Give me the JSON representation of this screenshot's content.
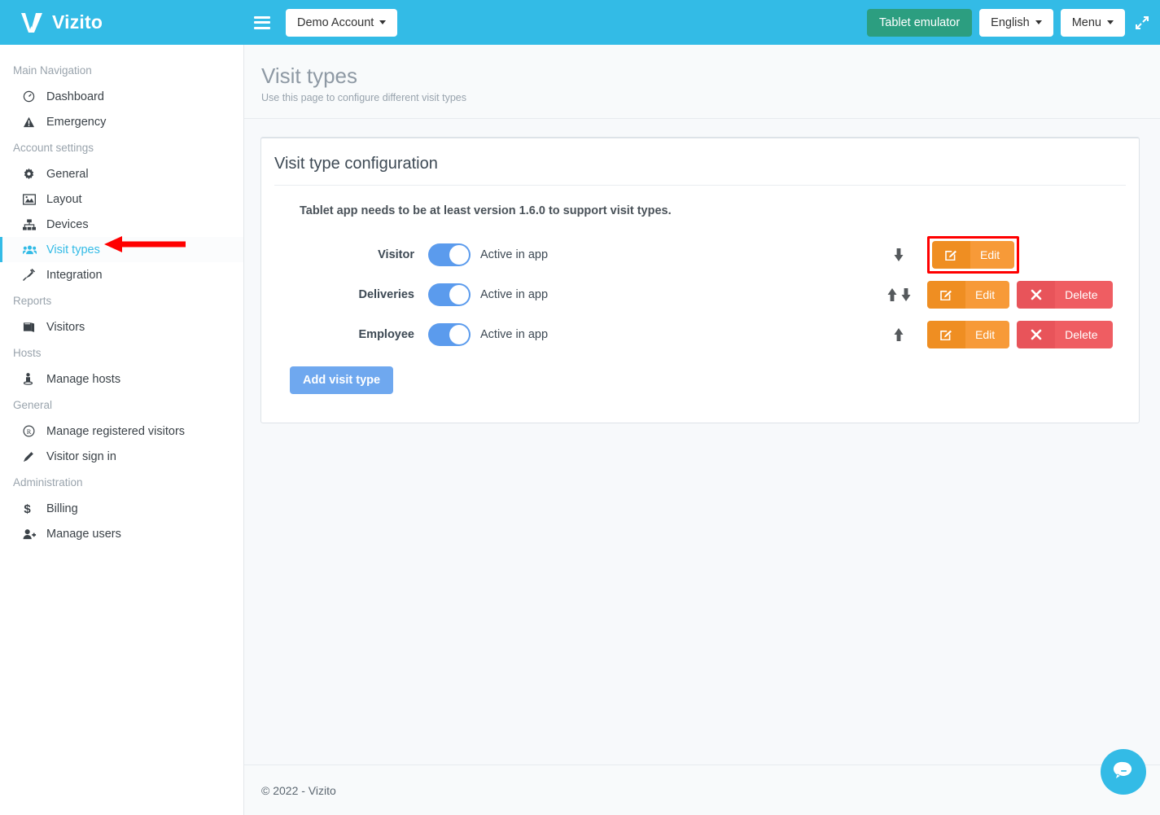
{
  "app": {
    "brand_name": "Vizito",
    "brand_logo_icon": "vizito-checkmark-logo",
    "accent_color": "#33bbe6"
  },
  "topbar": {
    "menu_toggle_icon": "hamburger-icon",
    "account_button": "Demo Account",
    "tablet_emulator_button": "Tablet emulator",
    "language_button": "English",
    "menu_button": "Menu",
    "expand_icon": "expand-arrows-icon",
    "emulator_color": "#2c9e80"
  },
  "sidebar": {
    "groups": [
      {
        "header": "Main Navigation",
        "items": [
          {
            "label": "Dashboard",
            "icon": "dashboard-gauge-icon",
            "active": false
          },
          {
            "label": "Emergency",
            "icon": "warning-triangle-icon",
            "active": false
          }
        ]
      },
      {
        "header": "Account settings",
        "items": [
          {
            "label": "General",
            "icon": "gear-icon",
            "active": false
          },
          {
            "label": "Layout",
            "icon": "image-icon",
            "active": false
          },
          {
            "label": "Devices",
            "icon": "sitemap-icon",
            "active": false
          },
          {
            "label": "Visit types",
            "icon": "users-group-icon",
            "active": true
          },
          {
            "label": "Integration",
            "icon": "plug-icon",
            "active": false
          }
        ]
      },
      {
        "header": "Reports",
        "items": [
          {
            "label": "Visitors",
            "icon": "book-icon",
            "active": false
          }
        ]
      },
      {
        "header": "Hosts",
        "items": [
          {
            "label": "Manage hosts",
            "icon": "person-pin-icon",
            "active": false
          }
        ]
      },
      {
        "header": "General",
        "items": [
          {
            "label": "Manage registered visitors",
            "icon": "registered-r-icon",
            "active": false
          },
          {
            "label": "Visitor sign in",
            "icon": "pencil-icon",
            "active": false
          }
        ]
      },
      {
        "header": "Administration",
        "items": [
          {
            "label": "Billing",
            "icon": "dollar-icon",
            "active": false
          },
          {
            "label": "Manage users",
            "icon": "user-plus-icon",
            "active": false
          }
        ]
      }
    ]
  },
  "page": {
    "title": "Visit types",
    "subtitle": "Use this page to configure different visit types"
  },
  "panel": {
    "title": "Visit type configuration",
    "notice": "Tablet app needs to be at least version 1.6.0 to support visit types.",
    "add_button": "Add visit type",
    "rows": [
      {
        "name": "Visitor",
        "toggle_on": true,
        "active_text": "Active in app",
        "move_up": false,
        "move_down": true,
        "edit_label": "Edit",
        "edit_icon": "edit-pencil-square-icon",
        "has_delete": false,
        "delete_label": "",
        "delete_icon": "",
        "highlighted": true
      },
      {
        "name": "Deliveries",
        "toggle_on": true,
        "active_text": "Active in app",
        "move_up": true,
        "move_down": true,
        "edit_label": "Edit",
        "edit_icon": "edit-pencil-square-icon",
        "has_delete": true,
        "delete_label": "Delete",
        "delete_icon": "cross-x-icon",
        "highlighted": false
      },
      {
        "name": "Employee",
        "toggle_on": true,
        "active_text": "Active in app",
        "move_up": true,
        "move_down": false,
        "edit_label": "Edit",
        "edit_icon": "edit-pencil-square-icon",
        "has_delete": true,
        "delete_label": "Delete",
        "delete_icon": "cross-x-icon",
        "highlighted": false
      }
    ]
  },
  "footer": {
    "copyright": "© 2022 - Vizito"
  },
  "chat": {
    "icon": "chat-bubble-icon"
  },
  "annotation": {
    "pointer_icon": "red-left-arrow-annotation",
    "color": "#ff0000"
  }
}
